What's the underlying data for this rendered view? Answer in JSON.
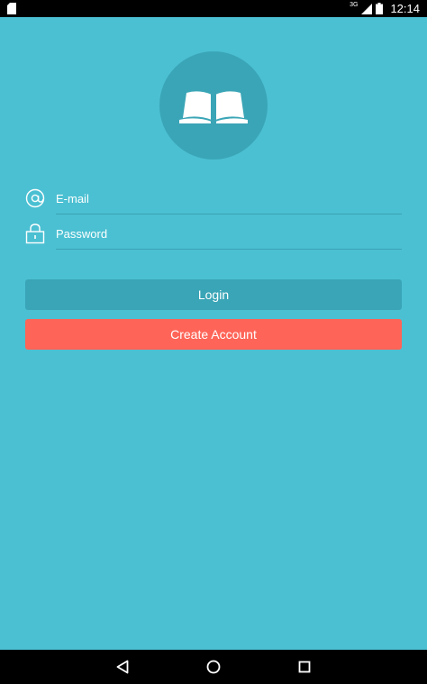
{
  "status_bar": {
    "network": "3G",
    "time": "12:14"
  },
  "login_form": {
    "email_placeholder": "E-mail",
    "password_placeholder": "Password",
    "login_label": "Login",
    "create_account_label": "Create Account"
  },
  "icons": {
    "logo": "open-book-icon",
    "email": "at-sign-icon",
    "password": "lock-icon"
  },
  "colors": {
    "background": "#4bc0d2",
    "accent_dark": "#3aa5b6",
    "create_button": "#fe6457",
    "text": "#ffffff"
  }
}
